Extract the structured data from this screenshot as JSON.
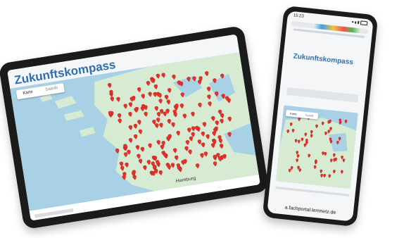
{
  "tablet": {
    "title": "Zukunftskompass",
    "tabs": [
      {
        "label": "Karte",
        "active": true
      },
      {
        "label": "Satellit",
        "active": false
      }
    ],
    "map_city_label": "Hamburg"
  },
  "phone": {
    "status_time": "15:23",
    "title": "Zukunftskompass",
    "tabs": [
      {
        "label": "Karte",
        "active": true
      },
      {
        "label": "Satellit",
        "active": false
      }
    ],
    "caption": "a.fachportal.lernnetz.de"
  },
  "colors": {
    "marker": "#e8302a",
    "water": "#a9d1e6",
    "land": "#d7ead2",
    "title": "#2f6fad",
    "device": "#1b1b1b"
  },
  "icons": [
    "map-marker-icon",
    "signal-icon",
    "battery-icon"
  ]
}
